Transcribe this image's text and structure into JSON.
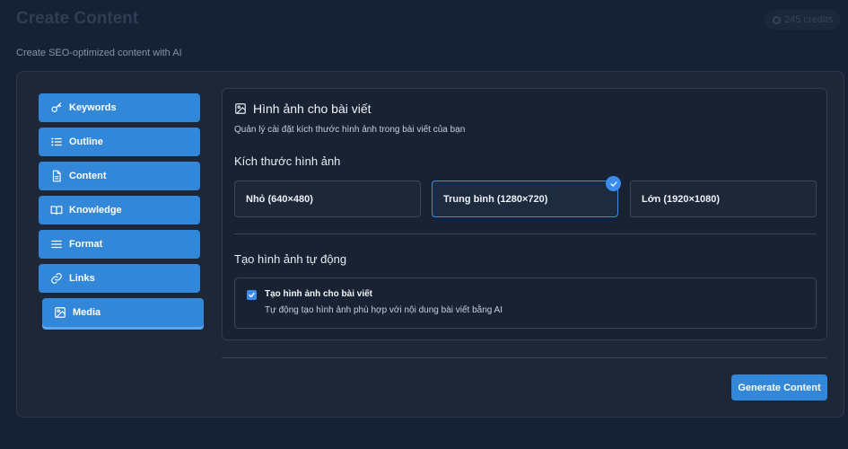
{
  "header": {
    "title": "Create Content",
    "subtitle": "Create SEO-optimized content with AI",
    "credits": "245 credits"
  },
  "sidebar": {
    "items": [
      {
        "label": "Keywords",
        "icon": "key-icon"
      },
      {
        "label": "Outline",
        "icon": "list-icon"
      },
      {
        "label": "Content",
        "icon": "document-icon"
      },
      {
        "label": "Knowledge",
        "icon": "book-icon"
      },
      {
        "label": "Format",
        "icon": "menu-lines-icon"
      },
      {
        "label": "Links",
        "icon": "link-icon"
      },
      {
        "label": "Media",
        "icon": "image-icon",
        "active": true
      }
    ]
  },
  "media_panel": {
    "title": "Hình ảnh cho bài viết",
    "description": "Quản lý cài đặt kích thước hình ảnh trong bài viết của bạn",
    "size_section_title": "Kích thước hình ảnh",
    "sizes": [
      {
        "label": "Nhỏ (640×480)",
        "selected": false
      },
      {
        "label": "Trung bình (1280×720)",
        "selected": true
      },
      {
        "label": "Lớn (1920×1080)",
        "selected": false
      }
    ],
    "auto_section_title": "Tạo hình ảnh tự động",
    "auto_option": {
      "label": "Tạo hình ảnh cho bài viết",
      "description": "Tự động tạo hình ảnh phù hợp với nội dung bài viết bằng AI",
      "checked": true
    }
  },
  "footer": {
    "generate_label": "Generate Content"
  },
  "colors": {
    "background": "#162133",
    "accent": "#3387d8",
    "selected_border": "#3a8cf0"
  }
}
